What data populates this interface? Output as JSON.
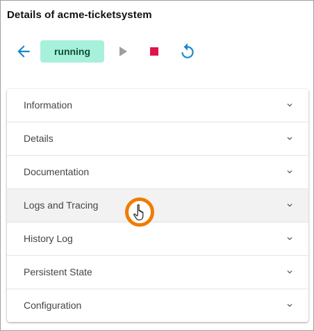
{
  "page": {
    "title": "Details of acme-ticketsystem"
  },
  "toolbar": {
    "back_icon": "arrow-left-icon",
    "status_label": "running",
    "play_icon": "play-icon",
    "stop_icon": "stop-icon",
    "restart_icon": "restart-icon"
  },
  "colors": {
    "accent": "#1a88c9",
    "status_chip_bg": "#a6f0dc",
    "status_chip_text": "#0e4f2f",
    "stop": "#e0144c",
    "play_disabled": "#9e9e9e",
    "cursor_ring": "#f07c00"
  },
  "panels": [
    {
      "label": "Information"
    },
    {
      "label": "Details"
    },
    {
      "label": "Documentation"
    },
    {
      "label": "Logs and Tracing"
    },
    {
      "label": "History Log"
    },
    {
      "label": "Persistent State"
    },
    {
      "label": "Configuration"
    }
  ],
  "cursor": {
    "icon": "hand-pointer-icon",
    "over_item": "Logs and Tracing"
  }
}
